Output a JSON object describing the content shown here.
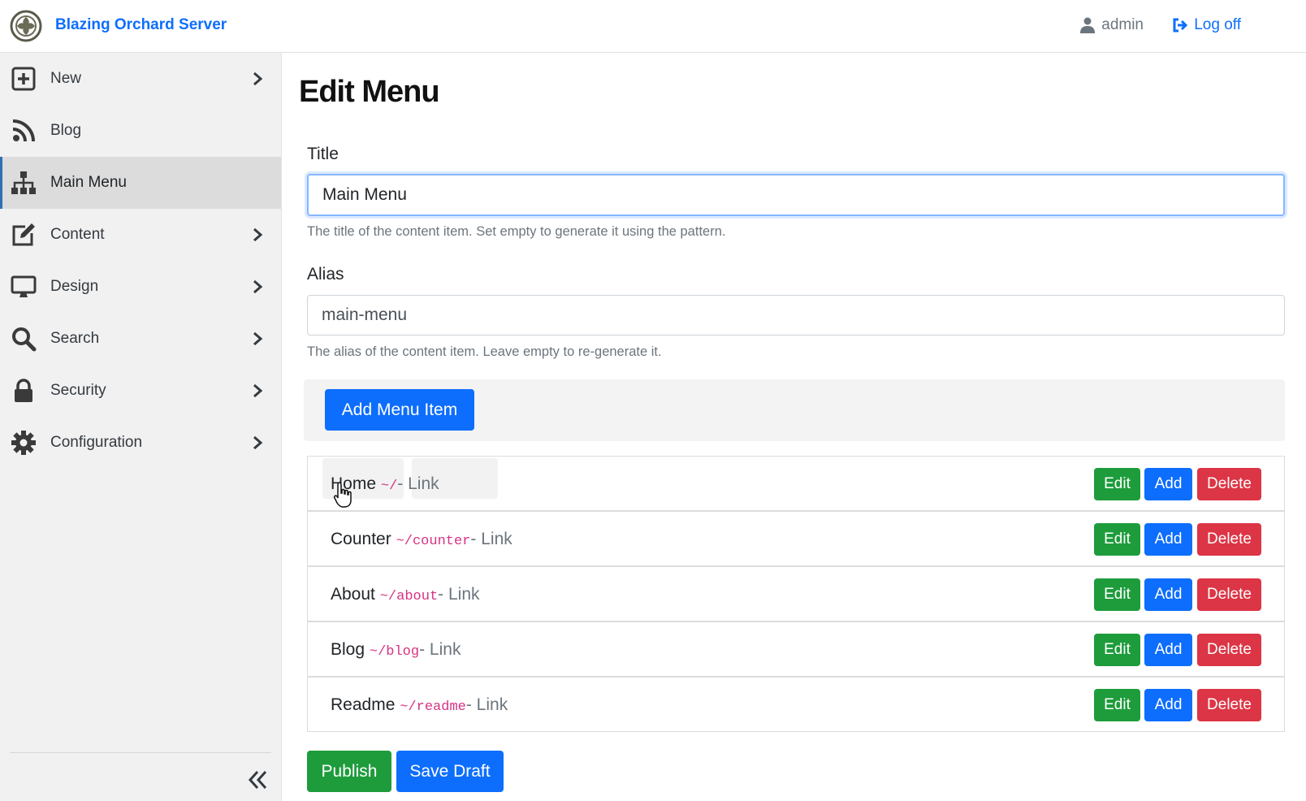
{
  "header": {
    "brand": "Blazing Orchard Server",
    "user": "admin",
    "logoff": "Log off"
  },
  "sidebar": {
    "items": [
      {
        "label": "New",
        "icon": "plus-square-icon",
        "has_chevron": true,
        "active": false
      },
      {
        "label": "Blog",
        "icon": "rss-icon",
        "has_chevron": false,
        "active": false
      },
      {
        "label": "Main Menu",
        "icon": "sitemap-icon",
        "has_chevron": false,
        "active": true
      },
      {
        "label": "Content",
        "icon": "edit-icon",
        "has_chevron": true,
        "active": false
      },
      {
        "label": "Design",
        "icon": "desktop-icon",
        "has_chevron": true,
        "active": false
      },
      {
        "label": "Search",
        "icon": "search-icon",
        "has_chevron": true,
        "active": false
      },
      {
        "label": "Security",
        "icon": "lock-icon",
        "has_chevron": true,
        "active": false
      },
      {
        "label": "Configuration",
        "icon": "gear-icon",
        "has_chevron": true,
        "active": false
      }
    ]
  },
  "main": {
    "page_title": "Edit Menu",
    "title_field": {
      "label": "Title",
      "value": "Main Menu",
      "hint": "The title of the content item. Set empty to generate it using the pattern."
    },
    "alias_field": {
      "label": "Alias",
      "value": "main-menu",
      "hint": "The alias of the content item. Leave empty to re-generate it."
    },
    "add_menu_item_label": "Add Menu Item",
    "menu_items": [
      {
        "name": "Home",
        "url": "~/",
        "type": "- Link"
      },
      {
        "name": "Counter",
        "url": "~/counter",
        "type": "- Link"
      },
      {
        "name": "About",
        "url": "~/about",
        "type": "- Link"
      },
      {
        "name": "Blog",
        "url": "~/blog",
        "type": "- Link"
      },
      {
        "name": "Readme",
        "url": "~/readme",
        "type": "- Link"
      }
    ],
    "row_actions": {
      "edit": "Edit",
      "add": "Add",
      "delete": "Delete"
    },
    "publish_label": "Publish",
    "save_draft_label": "Save Draft"
  },
  "colors": {
    "primary": "#0d6efd",
    "success": "#1e9c3c",
    "danger": "#dc3545",
    "url_pink": "#d63384"
  }
}
